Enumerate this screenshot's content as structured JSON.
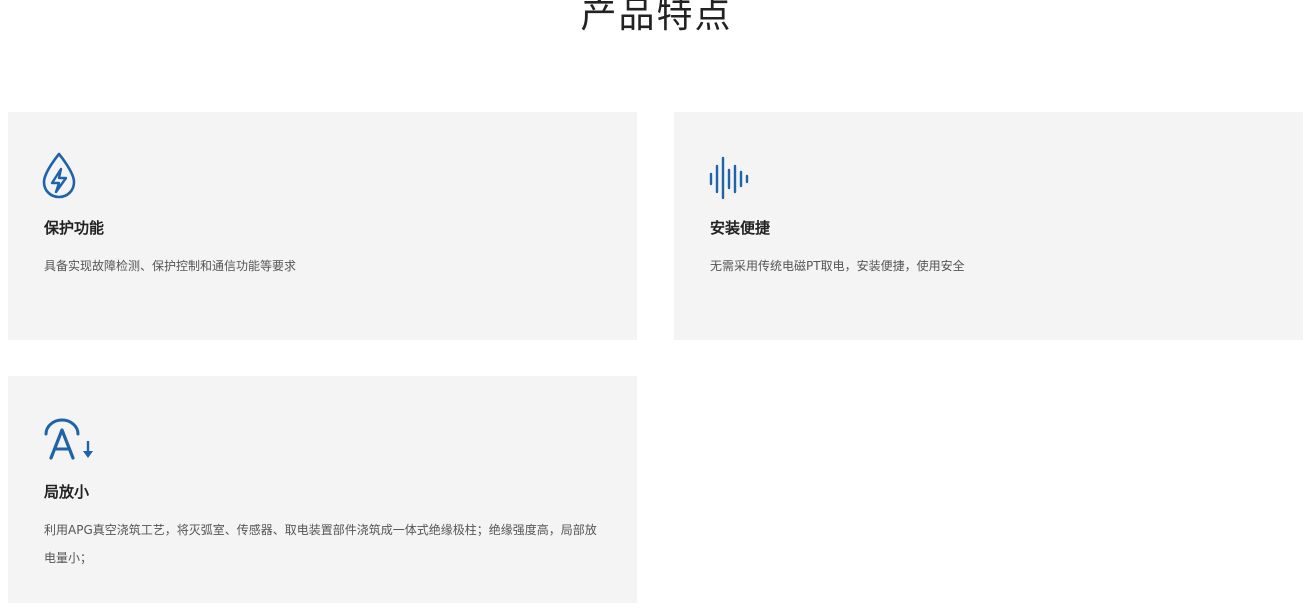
{
  "section": {
    "title": "产品特点"
  },
  "colors": {
    "accent": "#1f63a8",
    "card_bg": "#f4f4f4"
  },
  "features": [
    {
      "icon": "water-drop-lightning-icon",
      "title": "保护功能",
      "description": "具备实现故障检测、保护控制和通信功能等要求"
    },
    {
      "icon": "sound-wave-icon",
      "title": "安装便捷",
      "description": "无需采用传统电磁PT取电，安装便捷，使用安全"
    },
    {
      "icon": "letter-a-down-arrow-icon",
      "title": "局放小",
      "description": "利用APG真空浇筑工艺，将灭弧室、传感器、取电装置部件浇筑成一体式绝缘极柱；绝缘强度高，局部放电量小；"
    }
  ]
}
